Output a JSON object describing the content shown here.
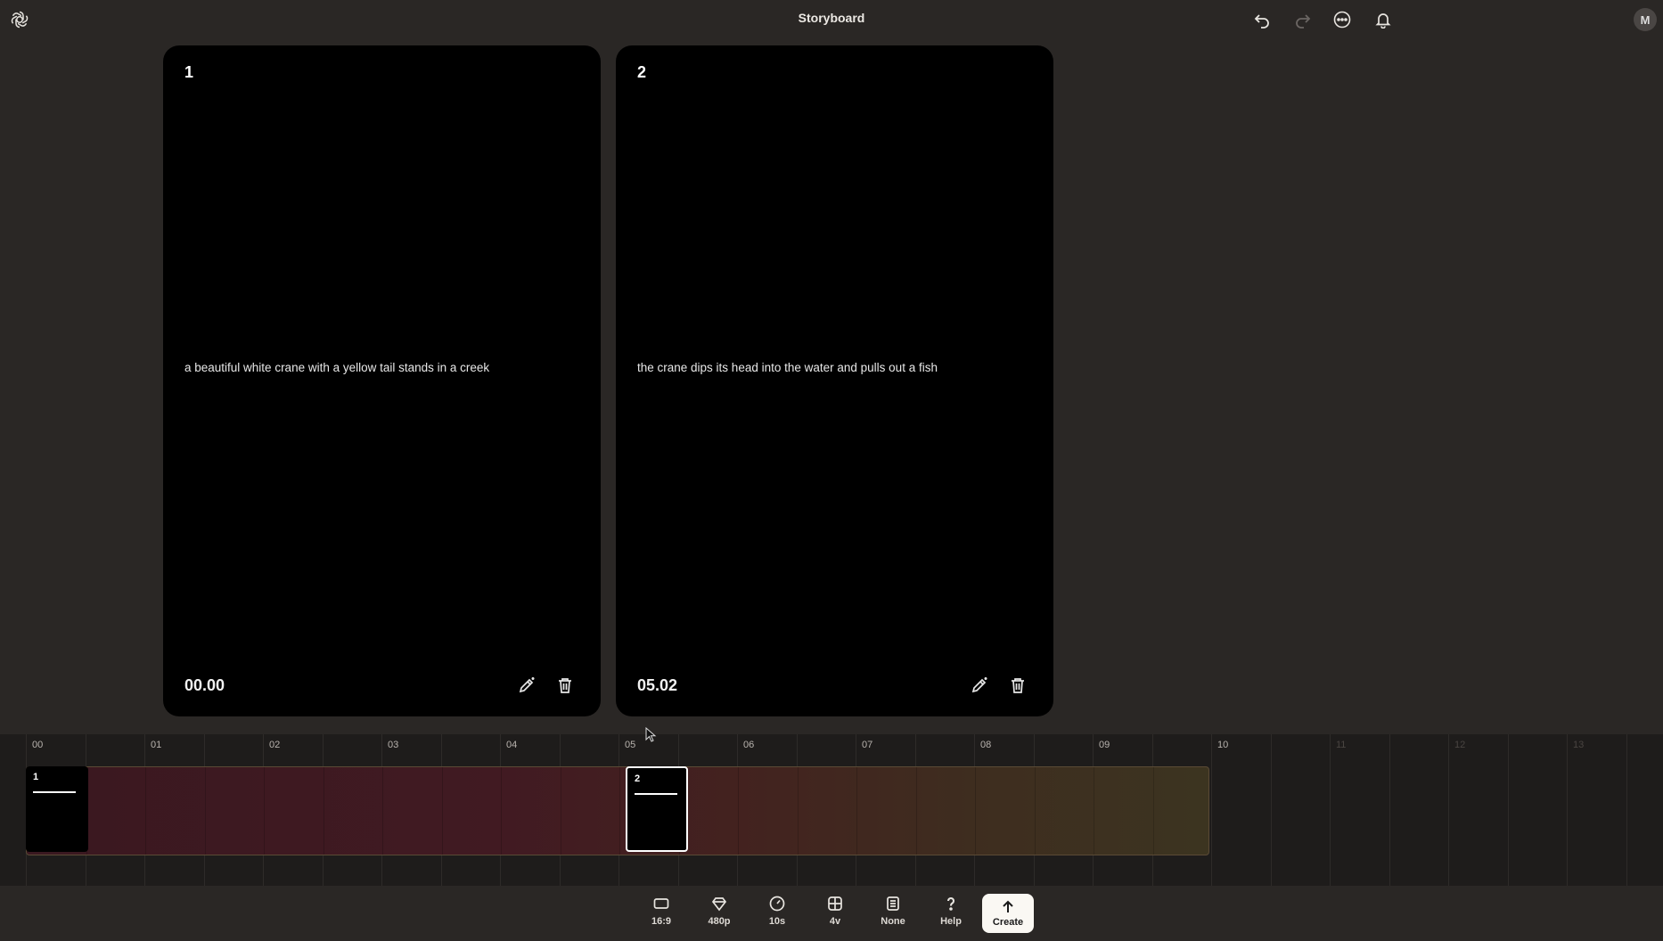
{
  "app": {
    "title": "Storyboard"
  },
  "user": {
    "initial": "M"
  },
  "header_icons": [
    "openai-logo-icon",
    "undo-icon",
    "redo-icon",
    "more-icon",
    "bell-icon"
  ],
  "cards": [
    {
      "number": "1",
      "prompt": "a beautiful white crane with a yellow tail stands in a creek",
      "time": "00.00"
    },
    {
      "number": "2",
      "prompt": "the crane dips its head into the water and pulls out a fish",
      "time": "05.02"
    }
  ],
  "timeline": {
    "ticks": [
      "00",
      "01",
      "02",
      "03",
      "04",
      "05",
      "06",
      "07",
      "08",
      "09",
      "10",
      "11",
      "12",
      "13"
    ],
    "active_until": 10,
    "clips": [
      {
        "number": "1",
        "start_seconds": 0,
        "selected": false
      },
      {
        "number": "2",
        "start_seconds": 5.02,
        "selected": true
      }
    ],
    "total_seconds": 10
  },
  "toolbar": {
    "aspect": "16:9",
    "resolution": "480p",
    "duration": "10s",
    "variations": "4v",
    "preset": "None",
    "help": "Help",
    "create": "Create"
  },
  "colors": {
    "background": "#2a2725",
    "card": "#000000",
    "timeline_bg": "#1e1c1b",
    "create_bg": "#faf8f3"
  }
}
